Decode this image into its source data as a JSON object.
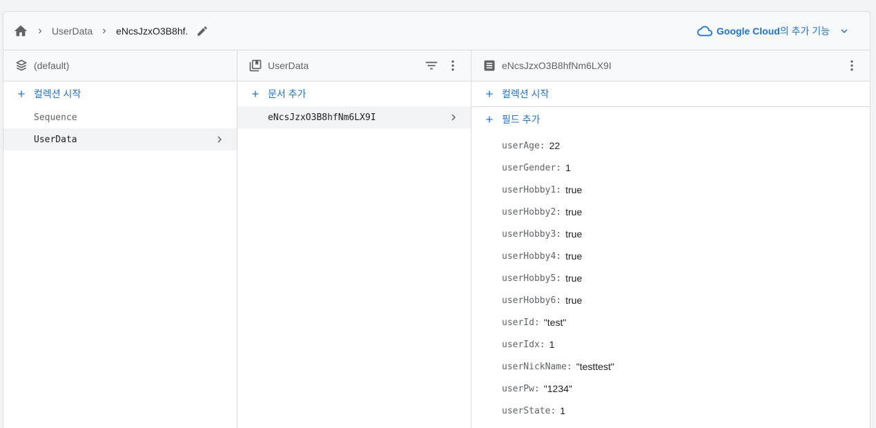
{
  "breadcrumb": {
    "items": [
      "UserData",
      "eNcsJzxO3B8hf."
    ]
  },
  "gcloud": {
    "brand": "Google Cloud",
    "suffix": "의 추가 기능"
  },
  "col1": {
    "title": "(default)",
    "add_label": "컬렉션 시작",
    "items": [
      "Sequence",
      "UserData"
    ]
  },
  "col2": {
    "title": "UserData",
    "add_label": "문서 추가",
    "items": [
      "eNcsJzxO3B8hfNm6LX9I"
    ]
  },
  "col3": {
    "title": "eNcsJzxO3B8hfNm6LX9I",
    "add_collection_label": "컬렉션 시작",
    "add_field_label": "필드 추가",
    "fields": [
      {
        "key": "userAge",
        "value": "22"
      },
      {
        "key": "userGender",
        "value": "1"
      },
      {
        "key": "userHobby1",
        "value": "true"
      },
      {
        "key": "userHobby2",
        "value": "true"
      },
      {
        "key": "userHobby3",
        "value": "true"
      },
      {
        "key": "userHobby4",
        "value": "true"
      },
      {
        "key": "userHobby5",
        "value": "true"
      },
      {
        "key": "userHobby6",
        "value": "true"
      },
      {
        "key": "userId",
        "value": "\"test\""
      },
      {
        "key": "userIdx",
        "value": "1"
      },
      {
        "key": "userNickName",
        "value": "\"testtest\""
      },
      {
        "key": "userPw",
        "value": "\"1234\""
      },
      {
        "key": "userState",
        "value": "1"
      }
    ]
  },
  "icons": {
    "home": "home-icon",
    "chevron": "chevron-right-icon",
    "edit": "pencil-icon",
    "cloud": "cloud-icon",
    "expand": "chevron-down-icon",
    "database": "database-icon",
    "collection": "collection-icon",
    "document": "document-icon",
    "filter": "filter-icon",
    "more": "more-vert-icon",
    "add": "plus-icon"
  },
  "colors": {
    "accent": "#1a73e8",
    "text": "#202124",
    "muted": "#5f6368",
    "border": "#dadce0"
  }
}
